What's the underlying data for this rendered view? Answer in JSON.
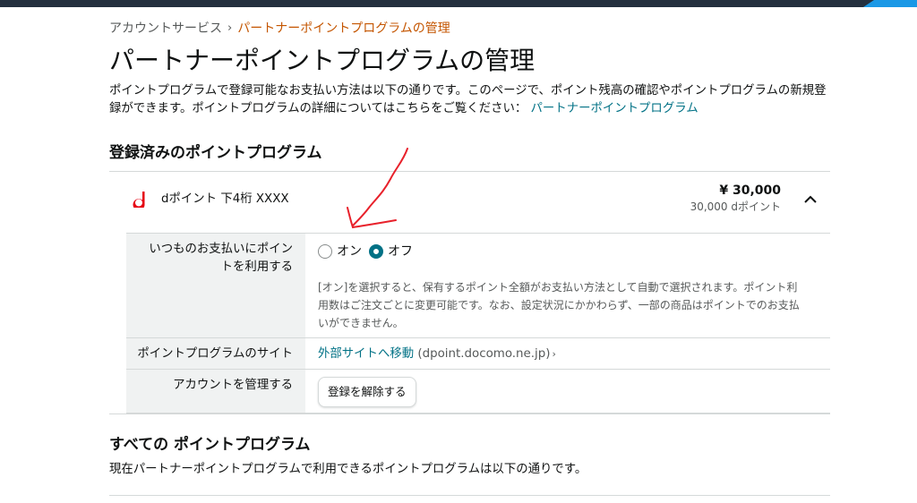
{
  "breadcrumb": {
    "parent": "アカウントサービス",
    "separator": "›",
    "current": "パートナーポイントプログラムの管理"
  },
  "page_title": "パートナーポイントプログラムの管理",
  "intro": {
    "text": "ポイントプログラムで登録可能なお支払い方法は以下の通りです。このページで、ポイント残高の確認やポイントプログラムの新規登録ができます。ポイントプログラムの詳細についてはこちらをご覧ください：",
    "link": "パートナーポイントプログラム"
  },
  "registered": {
    "title": "登録済みのポイントプログラム",
    "program": {
      "logo_icon": "d",
      "name": "dポイント 下4桁 XXXX",
      "amount": "¥ 30,000",
      "points": "30,000 dポイント"
    },
    "details": {
      "use_points_label": "いつものお支払いにポイントを利用する",
      "option_on": "オン",
      "option_off": "オフ",
      "selected": "off",
      "help_text": "[オン]を選択すると、保有するポイント全額がお支払い方法として自動で選択されます。ポイント利用数はご注文ごとに変更可能です。なお、設定状況にかかわらず、一部の商品はポイントでのお支払いができません。",
      "site_label": "ポイントプログラムのサイト",
      "site_link": "外部サイトへ移動",
      "site_domain": "(dpoint.docomo.ne.jp)",
      "site_arrow": "›",
      "manage_label": "アカウントを管理する",
      "unregister_button": "登録を解除する"
    }
  },
  "all_programs": {
    "title": "すべての ポイントプログラム",
    "description": "現在パートナーポイントプログラムで利用できるポイントプログラムは以下の通りです。"
  },
  "colors": {
    "accent": "#007185",
    "breadcrumb_current": "#c45500",
    "brand_d": "#e60012",
    "annotation": "#e8212b",
    "topbar": "#232f3e"
  }
}
